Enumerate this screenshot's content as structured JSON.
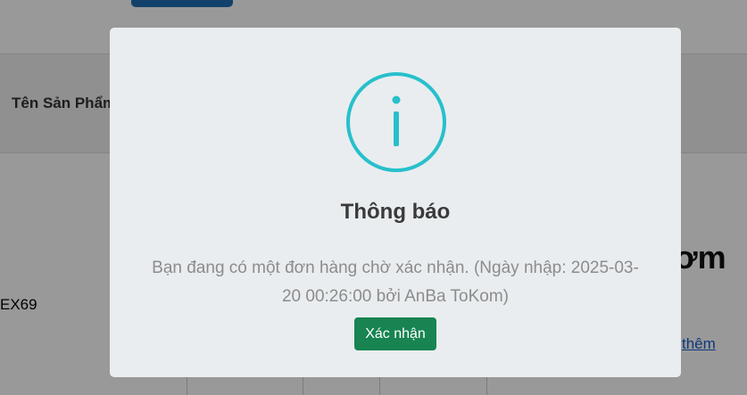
{
  "background": {
    "column_header": "Tên Sản Phẩm",
    "row_code": "EX69",
    "big_text": "ơm",
    "link_more": "thêm"
  },
  "modal": {
    "icon": "info-icon",
    "title": "Thông báo",
    "message": "Bạn đang có một đơn hàng chờ xác nhận. (Ngày nhập: 2025-03-20 00:26:00 bởi AnBa ToKom)",
    "confirm_label": "Xác nhận"
  },
  "colors": {
    "accent_icon": "#27c0cb",
    "confirm_button": "#178451",
    "top_button": "#1f6fb2"
  }
}
